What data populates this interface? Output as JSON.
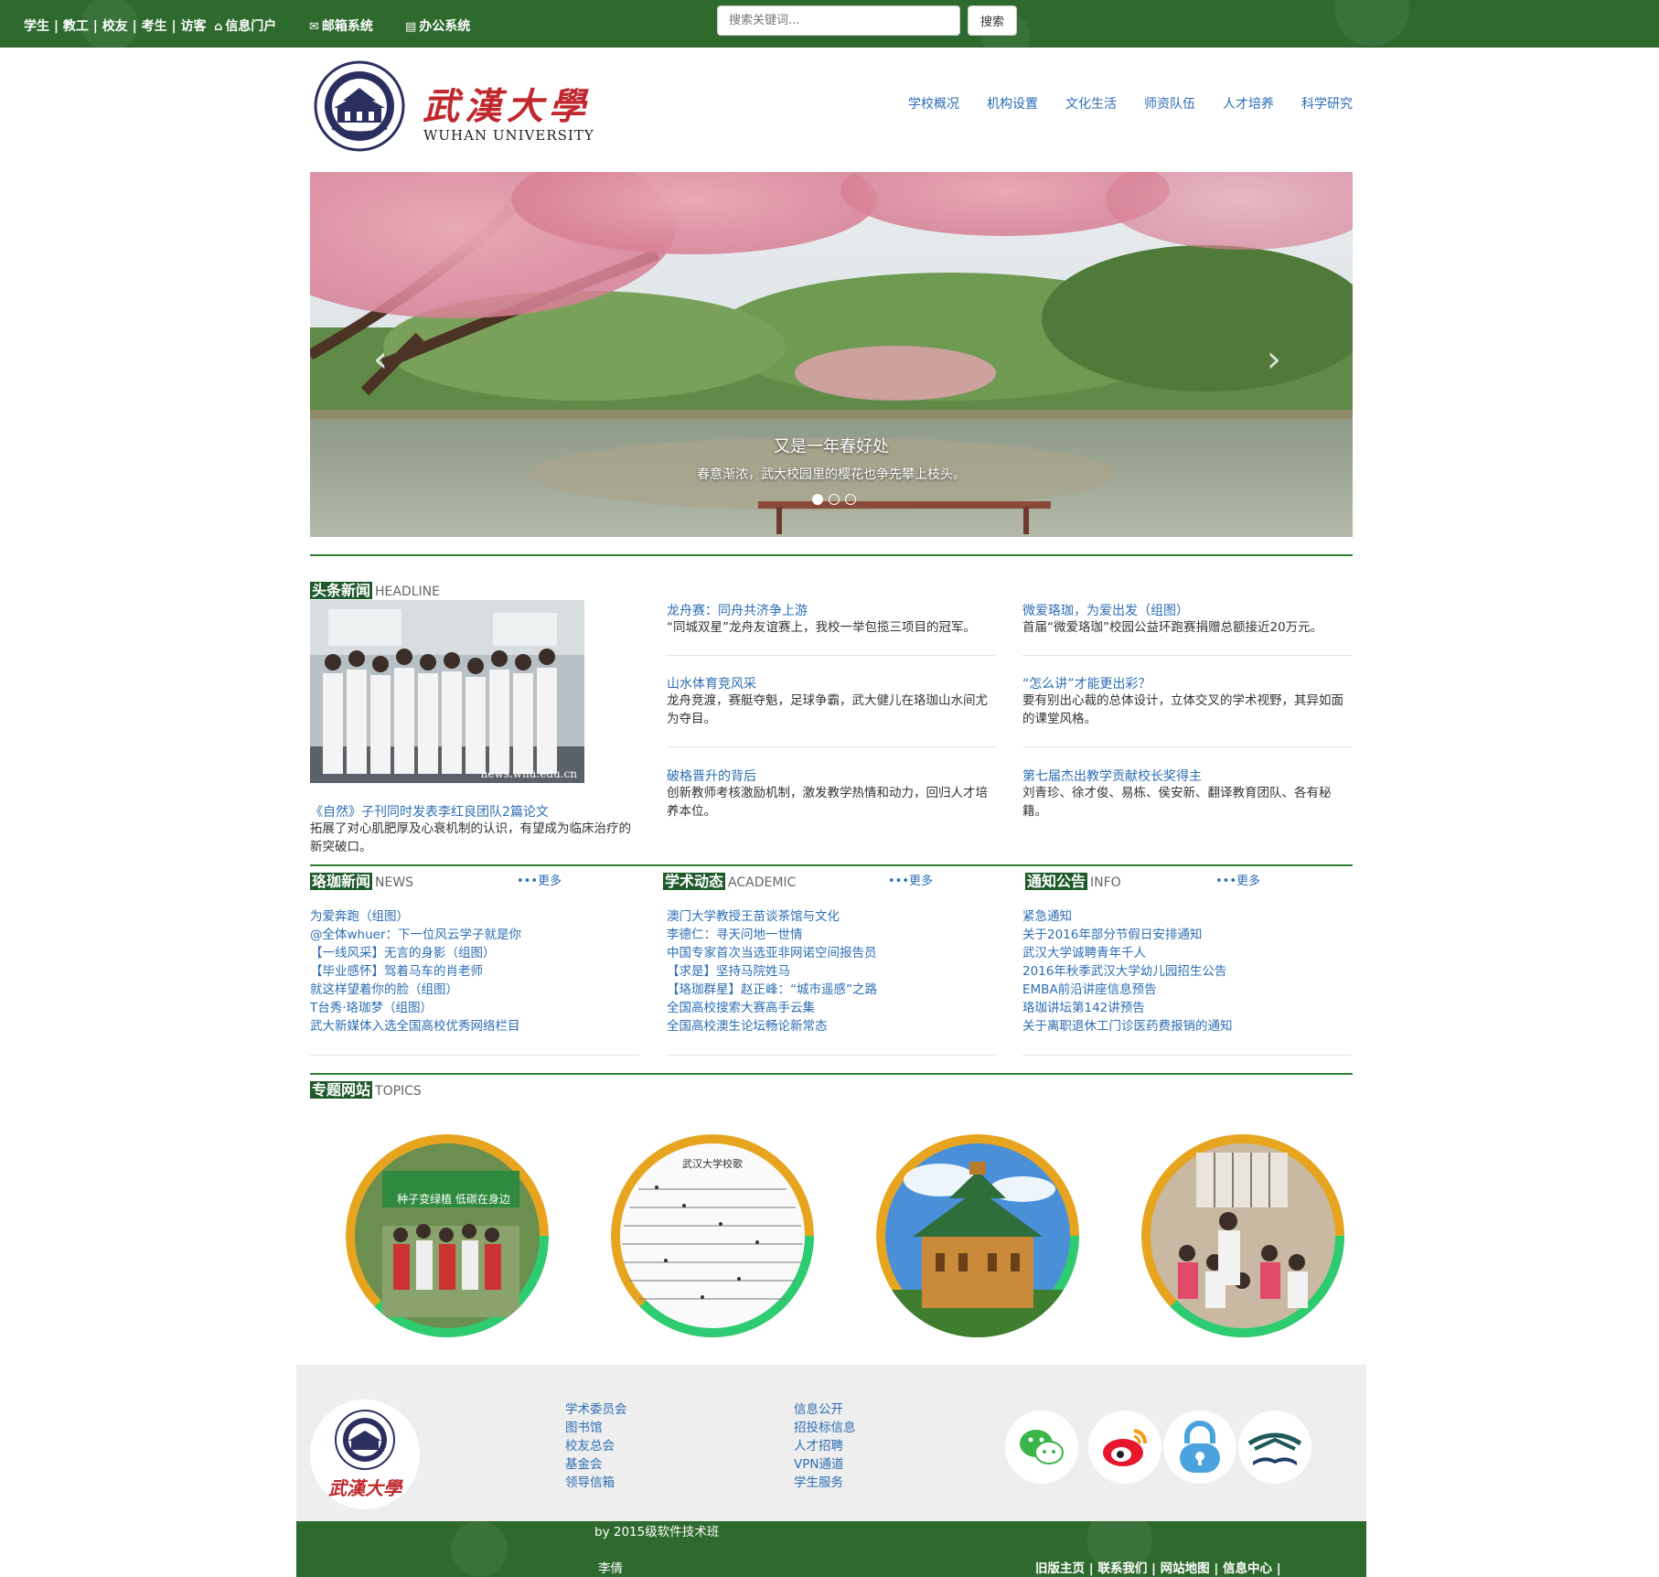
{
  "topbar": {
    "roles": "学生 | 教工 | 校友 | 考生 | 访客",
    "portal": "信息门户",
    "mail": "邮箱系统",
    "office": "办公系统",
    "search_placeholder": "搜索关键词...",
    "search_button": "搜索"
  },
  "header": {
    "logo_cn": "武漢大學",
    "logo_en": "WUHAN UNIVERSITY",
    "nav": [
      "学校概况",
      "机构设置",
      "文化生活",
      "师资队伍",
      "人才培养",
      "科学研究"
    ]
  },
  "slider": {
    "title": "又是一年春好处",
    "desc": "春意渐浓，武大校园里的樱花也争先攀上枝头。",
    "prev": "‹",
    "next": "›"
  },
  "headline": {
    "zh": "头条新闻",
    "en": "HEADLINE",
    "photo_watermark": "news.whu.edu.cn",
    "main": {
      "title": "《自然》子刊同时发表李红良团队2篇论文",
      "desc": "拓展了对心肌肥厚及心衰机制的认识，有望成为临床治疗的新突破口。"
    },
    "items": [
      {
        "title": "龙舟赛：同舟共济争上游",
        "desc": "“同城双星”龙舟友谊赛上，我校一举包揽三项目的冠军。"
      },
      {
        "title": "微爱珞珈，为爱出发（组图）",
        "desc": "首届“微爱珞珈”校园公益环跑赛捐赠总额接近20万元。"
      },
      {
        "title": "山水体育竞风采",
        "desc": "龙舟竞渡，赛艇夺魁，足球争霸，武大健儿在珞珈山水间尤为夺目。"
      },
      {
        "title": "“怎么讲”才能更出彩？",
        "desc": "要有别出心裁的总体设计，立体交叉的学术视野，其异如面的课堂风格。"
      },
      {
        "title": "破格晋升的背后",
        "desc": "创新教师考核激励机制，激发教学热情和动力，回归人才培养本位。"
      },
      {
        "title": "第七届杰出教学贡献校长奖得主",
        "desc": "刘青珍、徐才俊、易栋、侯安新、翻译教育团队、各有秘籍。"
      }
    ]
  },
  "news": {
    "zh": "珞珈新闻",
    "en": "NEWS",
    "more": "•••更多",
    "items": [
      "为爱奔跑（组图）",
      "@全体whuer：下一位风云学子就是你",
      "【一线风采】无言的身影（组图）",
      "【毕业感怀】驾着马车的肖老师",
      "就这样望着你的脸（组图）",
      "T台秀·珞珈梦（组图）",
      "武大新媒体入选全国高校优秀网络栏目"
    ]
  },
  "academic": {
    "zh": "学术动态",
    "en": "ACADEMIC",
    "more": "•••更多",
    "items": [
      "澳门大学教授王苗谈茶馆与文化",
      "李德仁：寻天问地一世情",
      "中国专家首次当选亚非网诺空间报告员",
      "【求是】坚持马院姓马",
      "【珞珈群星】赵正峰：“城市遥感”之路",
      "全国高校搜索大赛高手云集",
      "全国高校澳生论坛畅论新常态"
    ]
  },
  "info": {
    "zh": "通知公告",
    "en": "INFO",
    "more": "•••更多",
    "items": [
      "紧急通知",
      "关于2016年部分节假日安排通知",
      "武汉大学诚聘青年千人",
      "2016年秋季武汉大学幼儿园招生公告",
      "EMBA前沿讲座信息预告",
      "珞珈讲坛第142讲预告",
      "关于离职退休工门诊医药费报销的通知"
    ]
  },
  "topics": {
    "zh": "专题网站",
    "en": "TOPICS",
    "photo2_caption": "武汉大学校歌",
    "photo1_caption": "种子变绿植 低碳在身边"
  },
  "footer": {
    "col1": [
      "学术委员会",
      "图书馆",
      "校友总会",
      "基金会",
      "领导信箱"
    ],
    "col2": [
      "信息公开",
      "招投标信息",
      "人才招聘",
      "VPN通道",
      "学生服务"
    ],
    "credit": "by 2015级软件技术班",
    "author": "李倩",
    "bottom_links": "旧版主页 | 联系我们 | 网站地图 | 信息中心 |",
    "seal_text": "武漢大學"
  },
  "colors": {
    "brand_green": "#2e6a2e",
    "link_blue": "#2c6db4",
    "logo_red": "#c0282d"
  }
}
